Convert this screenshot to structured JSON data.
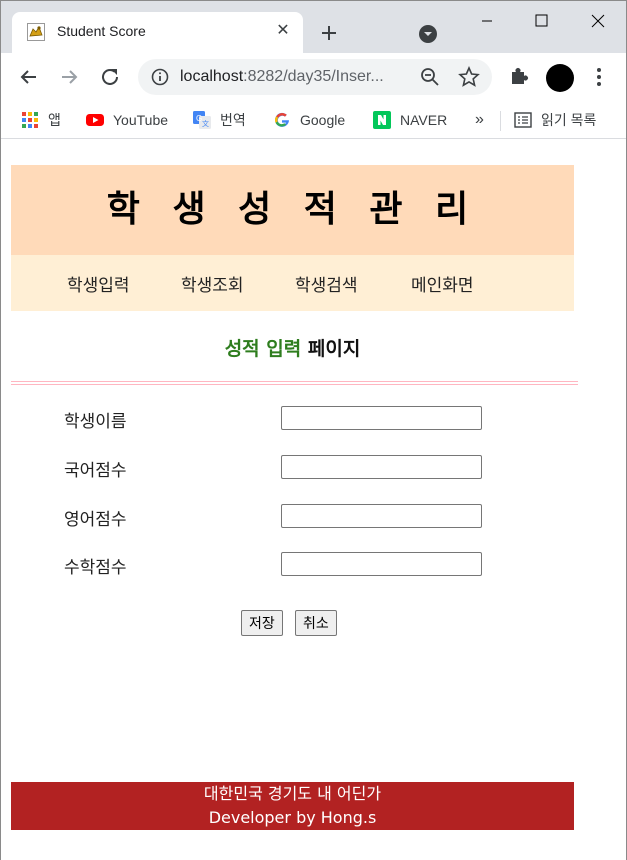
{
  "browser": {
    "tab_title": "Student Score",
    "url_host": "localhost",
    "url_rest": ":8282/day35/Inser...",
    "bookmarks": [
      {
        "label": "앱",
        "icon": "apps-grid-icon"
      },
      {
        "label": "YouTube",
        "icon": "youtube-icon"
      },
      {
        "label": "번역",
        "icon": "translate-icon"
      },
      {
        "label": "Google",
        "icon": "google-icon"
      },
      {
        "label": "NAVER",
        "icon": "naver-icon"
      }
    ],
    "more_bookmarks": "»",
    "reading_list": "읽기 목록"
  },
  "header": {
    "title": "학 생 성 적 관 리"
  },
  "menu": {
    "items": [
      {
        "label": "학생입력"
      },
      {
        "label": "학생조회"
      },
      {
        "label": "학생검색"
      },
      {
        "label": "메인화면"
      }
    ]
  },
  "page_heading": {
    "green_part": "성적 입력",
    "black_part": "페이지"
  },
  "form": {
    "fields": [
      {
        "label": "학생이름",
        "value": ""
      },
      {
        "label": "국어점수",
        "value": ""
      },
      {
        "label": "영어점수",
        "value": ""
      },
      {
        "label": "수학점수",
        "value": ""
      }
    ],
    "save_label": "저장",
    "cancel_label": "취소"
  },
  "footer": {
    "line1": "대한민국 경기도 내 어딘가",
    "line2": "Developer by Hong.s"
  },
  "colors": {
    "header_bg": "#ffdab9",
    "menu_bg": "#ffefd5",
    "heading_green": "#2e7d1e",
    "divider": "#ffb6c1",
    "footer_bg": "#b22222"
  }
}
